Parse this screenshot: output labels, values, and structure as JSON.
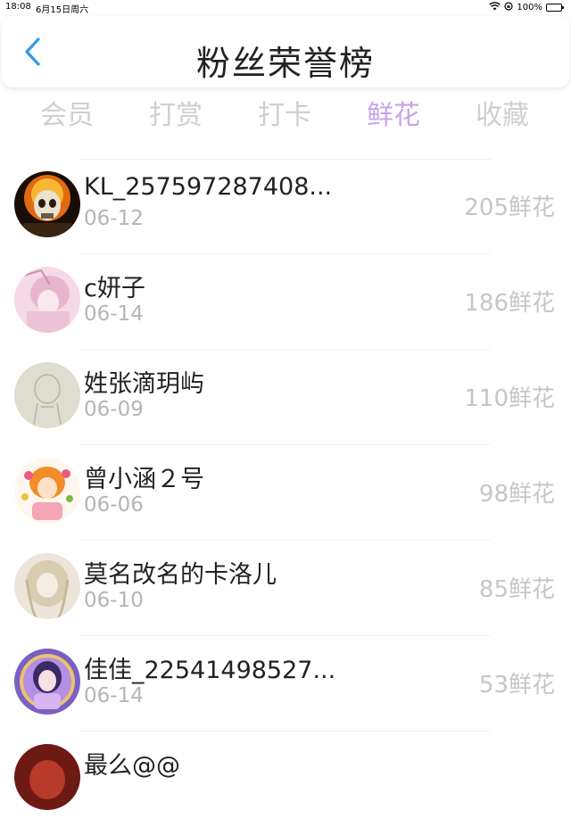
{
  "status_bar": {
    "time": "18:08",
    "date": "6月15日周六",
    "battery": "100%"
  },
  "header": {
    "title": "粉丝荣誉榜"
  },
  "tabs": [
    {
      "label": "会员"
    },
    {
      "label": "打赏"
    },
    {
      "label": "打卡"
    },
    {
      "label": "鲜花"
    },
    {
      "label": "收藏"
    }
  ],
  "active_tab": "鲜花",
  "colors": {
    "accent": "#c7a3ea",
    "back_arrow": "#2f9be8",
    "muted": "#c6c6c6"
  },
  "fans": [
    {
      "name": "KL_257597287408...",
      "date": "06-12",
      "amount": "205鲜花"
    },
    {
      "name": "c妍子",
      "date": "06-14",
      "amount": "186鲜花"
    },
    {
      "name": "姓张滴玥屿",
      "date": "06-09",
      "amount": "110鲜花"
    },
    {
      "name": "曾小涵２号",
      "date": "06-06",
      "amount": "98鲜花"
    },
    {
      "name": "莫名改名的卡洛儿",
      "date": "06-10",
      "amount": "85鲜花"
    },
    {
      "name": "佳佳_22541498527...",
      "date": "06-14",
      "amount": "53鲜花"
    },
    {
      "name": "最么@@",
      "date": "",
      "amount": ""
    }
  ]
}
